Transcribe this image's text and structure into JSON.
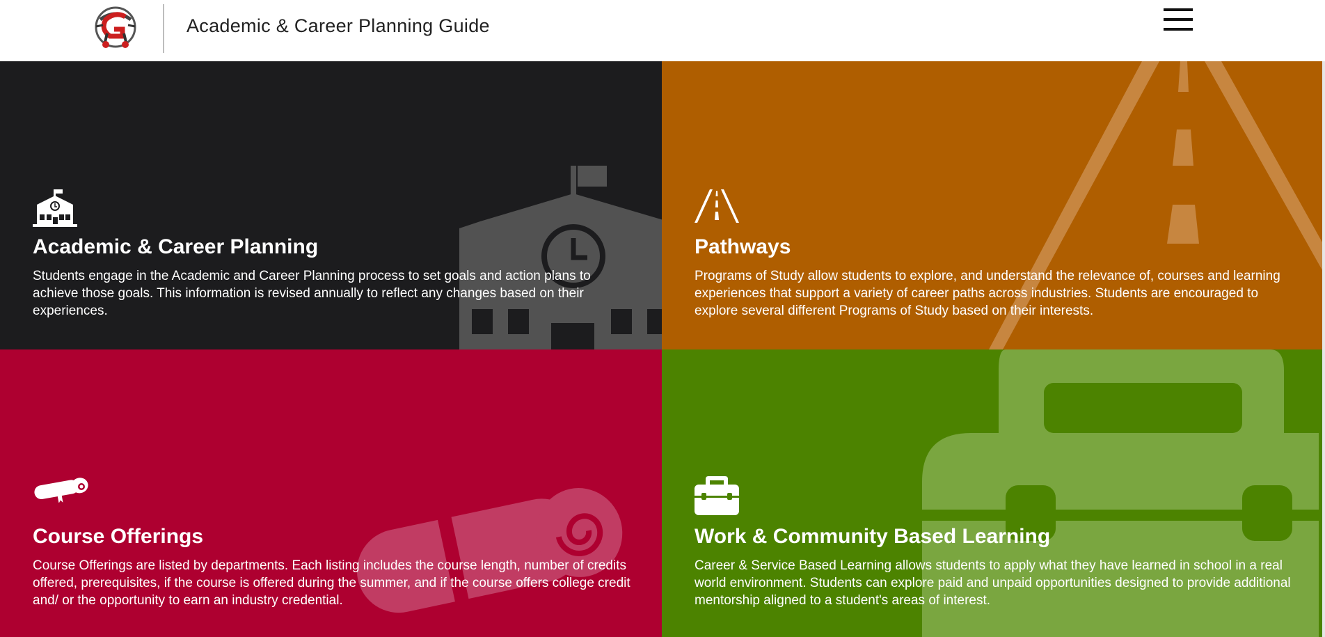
{
  "header": {
    "title": "Academic & Career Planning Guide",
    "logo_icon": "school-logo-icon",
    "menu_icon": "hamburger-menu-icon"
  },
  "tiles": [
    {
      "heading": "Academic & Career Planning",
      "text": "Students engage in the Academic and Career Planning process to set goals and action plans to achieve those goals. This information is revised annually to reflect any changes based on their experiences.",
      "icon": "school-building-icon",
      "color": "#1c1c1e"
    },
    {
      "heading": "Pathways",
      "text": "Programs of Study allow students to explore, and understand the relevance of, courses and learning experiences that support a variety of career paths across industries. Students are encouraged to explore several different Programs of Study based on their interests.",
      "icon": "road-icon",
      "color": "#af5e00"
    },
    {
      "heading": "Course Offerings",
      "text": "Course Offerings are listed by departments. Each listing includes the course length, number of credits offered, prerequisites, if the course is offered during the summer, and if the course offers college credit and/ or the opportunity to earn an industry credential.",
      "icon": "diploma-scroll-icon",
      "color": "#ae0030"
    },
    {
      "heading": "Work & Community Based Learning",
      "text": "Career & Service Based Learning allows students to apply what they have learned in school in a real world environment. Students can explore paid and unpaid opportunities designed to provide additional mentorship aligned to a student's areas of interest.",
      "icon": "briefcase-icon",
      "color": "#4c8300"
    }
  ]
}
